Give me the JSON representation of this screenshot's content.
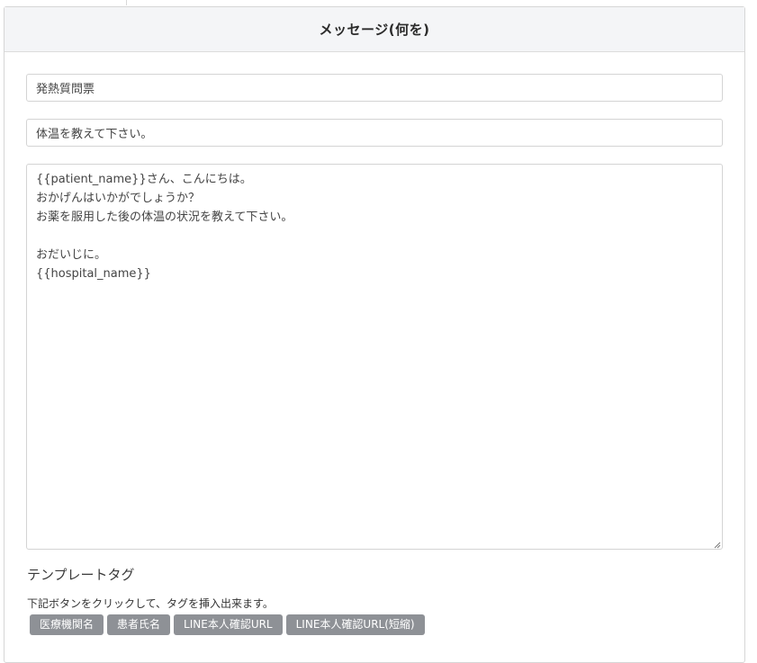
{
  "card": {
    "header_title": "メッセージ(何を)"
  },
  "form": {
    "title_value": "発熱質問票",
    "subject_value": "体温を教えて下さい。",
    "body_value": "{{patient_name}}さん、こんにちは。\nおかげんはいかがでしょうか？\nお薬を服用した後の体温の状況を教えて下さい。\n\nおだいじに。\n{{hospital_name}}"
  },
  "template_tags": {
    "heading": "テンプレートタグ",
    "help_text": "下記ボタンをクリックして、タグを挿入出来ます。",
    "buttons": [
      {
        "label": "医療機関名"
      },
      {
        "label": "患者氏名"
      },
      {
        "label": "LINE本人確認URL"
      },
      {
        "label": "LINE本人確認URL(短縮)"
      }
    ]
  },
  "colors": {
    "header_bg": "#f4f5f7",
    "tag_button_bg": "#8e9196",
    "border": "#d4d4d4"
  }
}
